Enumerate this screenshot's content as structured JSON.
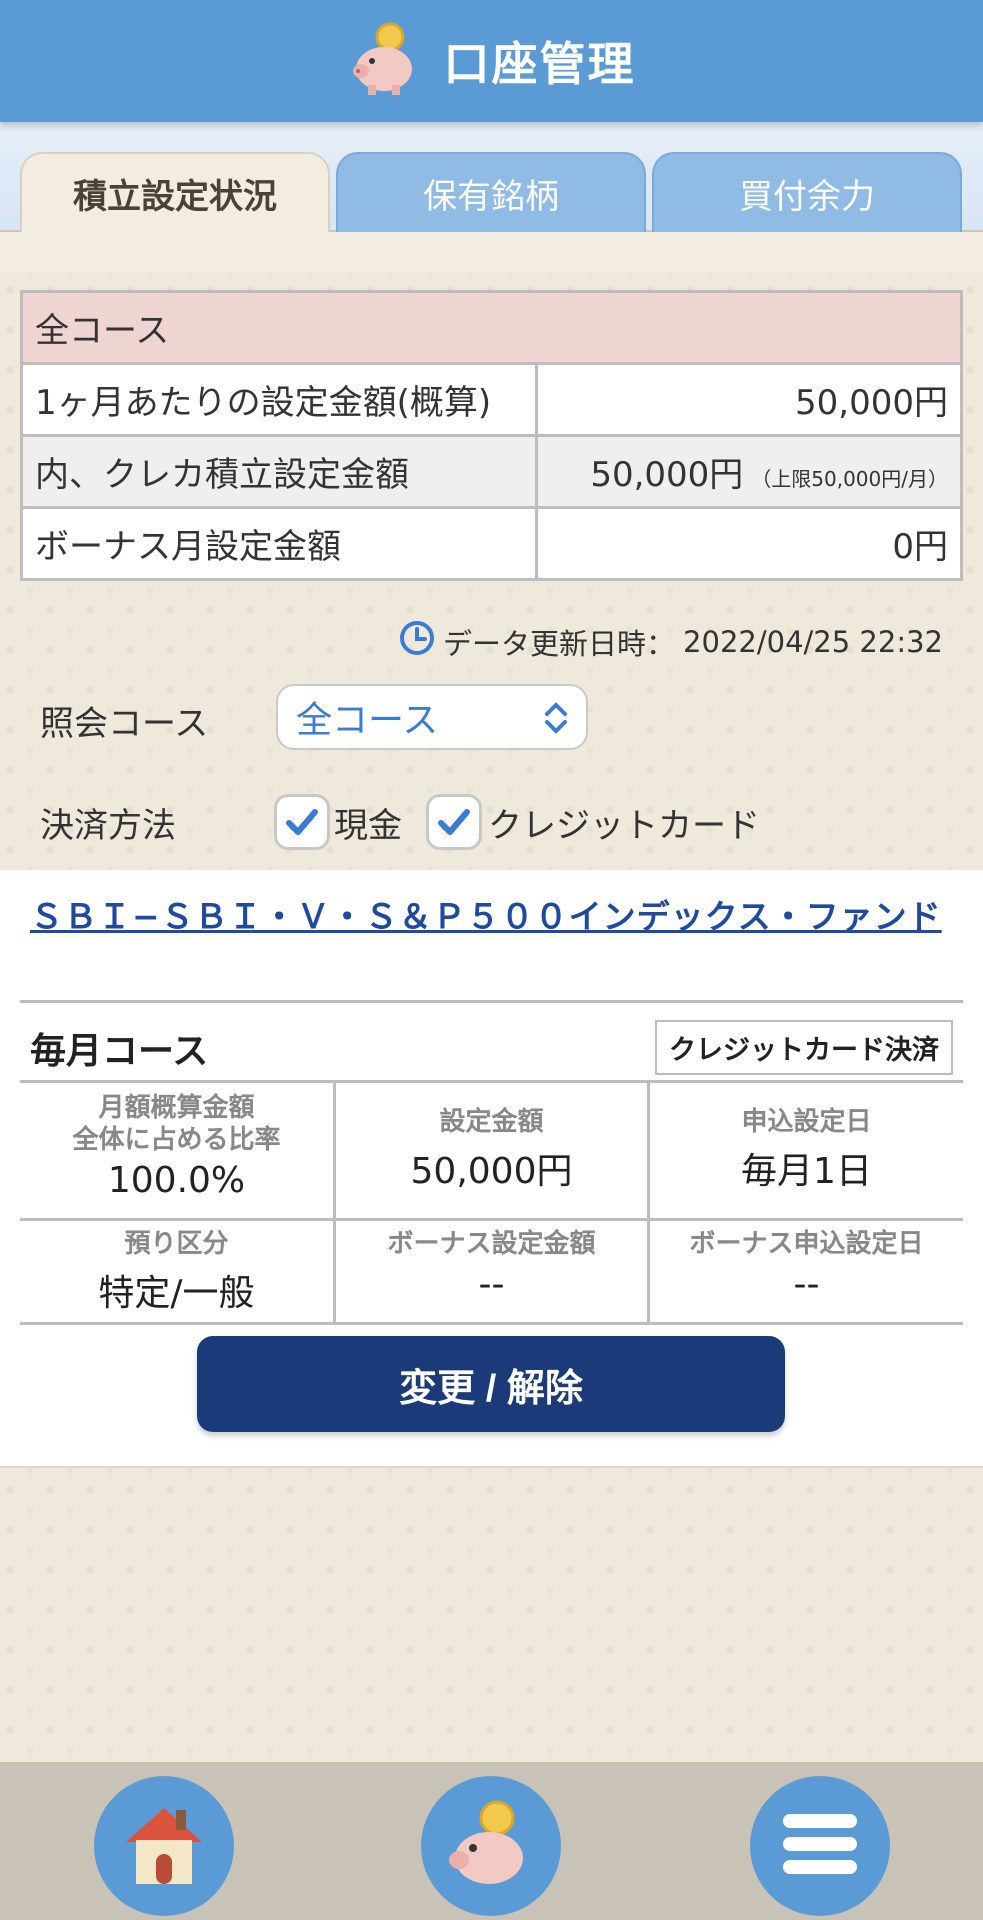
{
  "header": {
    "title": "口座管理",
    "icon": "piggy-bank-icon"
  },
  "tabs": [
    {
      "label": "積立設定状況",
      "active": true
    },
    {
      "label": "保有銘柄",
      "active": false
    },
    {
      "label": "買付余力",
      "active": false
    }
  ],
  "summary": {
    "heading": "全コース",
    "rows": [
      {
        "label": "1ヶ月あたりの設定金額(概算)",
        "value": "50,000円",
        "note": ""
      },
      {
        "label": "内、クレカ積立設定金額",
        "value": "50,000円",
        "note": "（上限50,000円/月）"
      },
      {
        "label": "ボーナス月設定金額",
        "value": "0円",
        "note": ""
      }
    ]
  },
  "update": {
    "label": "データ更新日時：",
    "datetime": "2022/04/25 22:32"
  },
  "filters": {
    "course_label": "照会コース",
    "course_value": "全コース",
    "payment_label": "決済方法",
    "payment_options": [
      {
        "label": "現金",
        "checked": true
      },
      {
        "label": "クレジットカード",
        "checked": true
      }
    ]
  },
  "fund": {
    "name": "ＳＢＩ−ＳＢＩ・Ｖ・Ｓ＆Ｐ５００インデックス・ファンド",
    "course": "毎月コース",
    "payment_badge": "クレジットカード決済",
    "cells": [
      {
        "label": "月額概算金額\n全体に占める比率",
        "value": "100.0%"
      },
      {
        "label": "設定金額",
        "value": "50,000円"
      },
      {
        "label": "申込設定日",
        "value": "毎月1日"
      },
      {
        "label": "預り区分",
        "value": "特定/一般"
      },
      {
        "label": "ボーナス設定金額",
        "value": "--"
      },
      {
        "label": "ボーナス申込設定日",
        "value": "--"
      }
    ],
    "action_label": "変更 / 解除"
  },
  "bottom_nav": [
    {
      "icon": "home-icon"
    },
    {
      "icon": "piggy-bank-icon"
    },
    {
      "icon": "menu-icon"
    }
  ],
  "colors": {
    "header": "#5b9bd5",
    "accent": "#3a7bd5",
    "button": "#1b3a7a",
    "link": "#1f4aa0"
  }
}
